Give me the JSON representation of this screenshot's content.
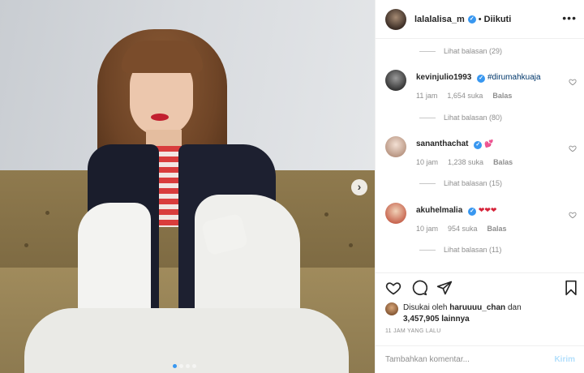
{
  "post": {
    "username": "lalalalisa_m",
    "separator": "•",
    "follow_label": "Diikuti",
    "more_label": "•••"
  },
  "comments": {
    "top_view_replies": "Lihat balasan (29)",
    "items": [
      {
        "username": "kevinjulio1993",
        "verified": true,
        "text": "#dirumahkuaja",
        "time": "11 jam",
        "likes": "1,654 suka",
        "reply_label": "Balas",
        "view_replies": "Lihat balasan (80)"
      },
      {
        "username": "sananthachat",
        "verified": true,
        "text": "💕",
        "time": "10 jam",
        "likes": "1,238 suka",
        "reply_label": "Balas",
        "view_replies": "Lihat balasan (15)"
      },
      {
        "username": "akuhelmalia",
        "verified": true,
        "text": "❤❤❤",
        "time": "10 jam",
        "likes": "954 suka",
        "reply_label": "Balas",
        "view_replies": "Lihat balasan (11)"
      }
    ]
  },
  "likes": {
    "prefix": "Disukai oleh",
    "user": "haruuuu_chan",
    "connector": "dan",
    "count": "3,457,905",
    "suffix": "lainnya"
  },
  "timestamp": "11 JAM YANG LALU",
  "comment_box": {
    "placeholder": "Tambahkan komentar...",
    "post_label": "Kirim"
  },
  "carousel": {
    "next_label": "›",
    "slide_count": 4,
    "active_index": 0
  },
  "colors": {
    "verified_blue": "#3897f0",
    "hashtag": "#00376b",
    "muted": "#8e8e8e",
    "post_disabled": "#b2dffc",
    "heart_red": "#ed4956"
  }
}
